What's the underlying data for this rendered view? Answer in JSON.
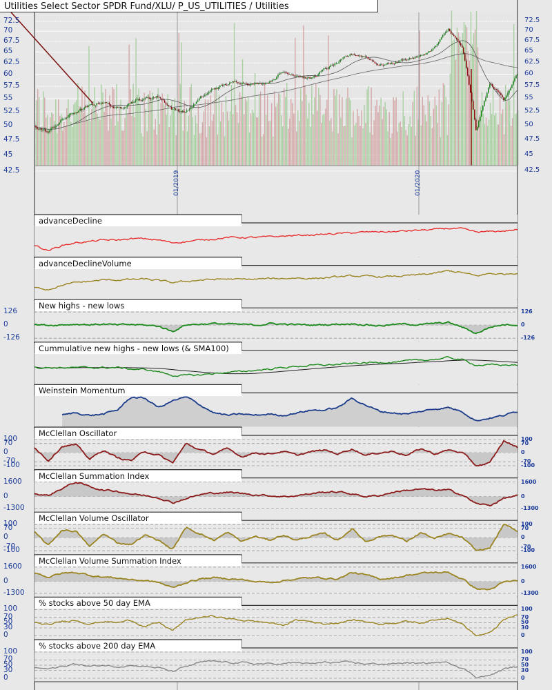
{
  "title": "Utilities Select Sector SPDR Fund/XLU/ P_US_UTILITIES / Utilities",
  "colors": {
    "up": "#1a8a1a",
    "down": "#8b1010",
    "vol_up": "#a8d0a0",
    "vol_down": "#d4a8a8",
    "axis_text": "#1a3a9a"
  },
  "chart_data": [
    {
      "type": "line",
      "name": "price",
      "title": "Utilities Select Sector SPDR Fund/XLU/ P_US_UTILITIES / Utilities",
      "y_ticks": [
        "72.5",
        "70",
        "67.5",
        "65",
        "62.5",
        "60",
        "57.5",
        "55",
        "52.5",
        "50",
        "47.5",
        "45",
        "42.5"
      ],
      "y_tick_values": [
        72.5,
        70,
        67.5,
        65,
        62.5,
        60,
        57.5,
        55,
        52.5,
        50,
        47.5,
        45,
        42.5
      ],
      "ylim": [
        42.5,
        72.5
      ],
      "x_labels": [
        "01/2019",
        "01/2020"
      ],
      "close": [
        50,
        48.8,
        51,
        52.5,
        53.5,
        54.5,
        53,
        54.5,
        55,
        55.5,
        53,
        52.5,
        55,
        57,
        58,
        58.5,
        58,
        58.5,
        60.5,
        60,
        59,
        61,
        62.5,
        64.5,
        64,
        62,
        62.5,
        63.5,
        64,
        66,
        70.5,
        66,
        49,
        58,
        55,
        60
      ],
      "overlays": [
        "SMA50",
        "SMA200"
      ]
    },
    {
      "type": "line",
      "name": "advanceDecline",
      "label": "advanceDecline",
      "color": "#e83030",
      "values": [
        0.3,
        0.1,
        0.3,
        0.4,
        0.45,
        0.5,
        0.5,
        0.55,
        0.55,
        0.5,
        0.4,
        0.45,
        0.5,
        0.55,
        0.6,
        0.6,
        0.6,
        0.62,
        0.65,
        0.68,
        0.7,
        0.72,
        0.75,
        0.78,
        0.8,
        0.82,
        0.82,
        0.85,
        0.88,
        0.9,
        0.95,
        0.92,
        0.8,
        0.82,
        0.85,
        0.9
      ]
    },
    {
      "type": "line",
      "name": "advanceDeclineVolume",
      "label": "advanceDeclineVolume",
      "color": "#9a8420",
      "values": [
        0.3,
        0.25,
        0.4,
        0.5,
        0.55,
        0.6,
        0.6,
        0.62,
        0.63,
        0.58,
        0.5,
        0.55,
        0.6,
        0.62,
        0.64,
        0.62,
        0.63,
        0.65,
        0.66,
        0.68,
        0.66,
        0.68,
        0.72,
        0.75,
        0.74,
        0.72,
        0.74,
        0.76,
        0.8,
        0.85,
        0.95,
        0.88,
        0.75,
        0.85,
        0.82,
        0.88
      ]
    },
    {
      "type": "line",
      "name": "newHighsNewLows",
      "label": "New highs - new lows",
      "color": "#1a8a1a",
      "ylim": [
        -126,
        126
      ],
      "left_ticks": [
        "126",
        "0",
        "-126"
      ],
      "right_ticks": [
        "126",
        "0",
        "-126"
      ],
      "tick_values": [
        126,
        0,
        -126
      ],
      "fill_zero": true,
      "values": [
        5,
        0,
        5,
        10,
        5,
        10,
        0,
        5,
        0,
        -10,
        -60,
        5,
        10,
        15,
        10,
        5,
        0,
        15,
        10,
        5,
        0,
        5,
        10,
        15,
        5,
        -5,
        5,
        10,
        5,
        15,
        25,
        -20,
        -80,
        -20,
        5,
        5
      ]
    },
    {
      "type": "line",
      "name": "cumulativeNewHighsNewLows",
      "label": "Cummulative new highs - new lows (& SMA100)",
      "color": "#1a8a1a",
      "overlay": "SMA100",
      "values": [
        0.5,
        0.5,
        0.5,
        0.5,
        0.5,
        0.5,
        0.5,
        0.45,
        0.42,
        0.35,
        0.2,
        0.2,
        0.22,
        0.28,
        0.32,
        0.35,
        0.4,
        0.45,
        0.5,
        0.55,
        0.58,
        0.6,
        0.62,
        0.65,
        0.68,
        0.7,
        0.72,
        0.75,
        0.78,
        0.82,
        0.88,
        0.8,
        0.6,
        0.6,
        0.6,
        0.6
      ]
    },
    {
      "type": "area",
      "name": "weinsteinMomentum",
      "label": "Weinstein Momentum",
      "color": "#1a3a8a",
      "start_index": 2,
      "values": [
        null,
        null,
        0.3,
        0.4,
        0.3,
        0.35,
        0.5,
        1.0,
        0.95,
        0.6,
        0.85,
        1.0,
        0.7,
        0.4,
        0.3,
        0.35,
        0.3,
        0.35,
        0.3,
        0.4,
        0.5,
        0.5,
        0.6,
        0.95,
        0.7,
        0.45,
        0.4,
        0.35,
        0.45,
        0.55,
        0.6,
        0.45,
        0.1,
        0.2,
        0.3,
        0.45
      ]
    },
    {
      "type": "line",
      "name": "mcclellanOscillator",
      "label": "McClellan Oscillator",
      "color": "#8b1a1a",
      "ylim": [
        -100,
        100
      ],
      "left_ticks": [
        "100",
        "70",
        "0",
        "-70",
        "-100"
      ],
      "right_ticks": [
        "100",
        "70",
        "0",
        "-70",
        "-100"
      ],
      "tick_values": [
        100,
        70,
        0,
        -70,
        -100
      ],
      "fill_zero": true,
      "values": [
        40,
        -60,
        50,
        60,
        -50,
        20,
        -40,
        -60,
        10,
        -20,
        -80,
        70,
        20,
        -10,
        30,
        -30,
        0,
        -10,
        10,
        -20,
        5,
        20,
        -10,
        30,
        -20,
        0,
        10,
        -20,
        30,
        -10,
        20,
        0,
        -100,
        -80,
        90,
        40
      ]
    },
    {
      "type": "line",
      "name": "mcclellanSummationIndex",
      "label": "McClellan Summation Index",
      "color": "#8b1a1a",
      "ylim": [
        -1300,
        1600
      ],
      "left_ticks": [
        "1600",
        "0",
        "-1300"
      ],
      "right_ticks": [
        "1600",
        "0",
        "-1300"
      ],
      "tick_values": [
        1600,
        0,
        -1300
      ],
      "fill_zero": true,
      "values": [
        300,
        100,
        900,
        1600,
        1100,
        700,
        600,
        300,
        100,
        -100,
        -700,
        -200,
        200,
        400,
        450,
        350,
        200,
        100,
        0,
        100,
        300,
        500,
        500,
        300,
        0,
        100,
        500,
        700,
        800,
        700,
        700,
        200,
        -800,
        -1000,
        -200,
        100
      ]
    },
    {
      "type": "line",
      "name": "mcclellanVolumeOscillator",
      "label": "McClellan Volume Oscillator",
      "color": "#9a8420",
      "ylim": [
        -100,
        100
      ],
      "left_ticks": [
        "100",
        "70",
        "0",
        "-70",
        "-100"
      ],
      "right_ticks": [
        "100",
        "70",
        "0",
        "-70",
        "-100"
      ],
      "tick_values": [
        100,
        70,
        0,
        -70,
        -100
      ],
      "fill_zero": true,
      "values": [
        40,
        -60,
        60,
        50,
        -70,
        30,
        -40,
        -50,
        20,
        -20,
        -90,
        80,
        30,
        -20,
        40,
        -30,
        10,
        -20,
        20,
        -20,
        10,
        30,
        -20,
        70,
        -30,
        10,
        20,
        -30,
        40,
        -10,
        30,
        0,
        -100,
        -80,
        100,
        50
      ]
    },
    {
      "type": "line",
      "name": "mcclellanVolumeSummationIndex",
      "label": "McClellan Volume Summation Index",
      "color": "#9a8420",
      "ylim": [
        -1300,
        1600
      ],
      "left_ticks": [
        "1600",
        "0",
        "-1300"
      ],
      "right_ticks": [
        "1600",
        "0",
        "-1300"
      ],
      "tick_values": [
        1600,
        0,
        -1300
      ],
      "fill_zero": true,
      "values": [
        1000,
        500,
        900,
        1000,
        700,
        500,
        400,
        200,
        100,
        -100,
        -700,
        -100,
        300,
        400,
        350,
        200,
        0,
        -100,
        100,
        300,
        400,
        400,
        300,
        1000,
        700,
        300,
        400,
        700,
        900,
        1000,
        1000,
        300,
        -800,
        -900,
        -100,
        100
      ]
    },
    {
      "type": "line",
      "name": "pctAbove50EMA",
      "label": "% stocks above 50 day EMA",
      "color": "#9a8420",
      "ylim": [
        0,
        100
      ],
      "left_ticks": [
        "100",
        "70",
        "50",
        "30",
        "0"
      ],
      "right_ticks": [
        "100",
        "70",
        "50",
        "30",
        "0"
      ],
      "tick_values": [
        100,
        70,
        50,
        30,
        0
      ],
      "fill_zero": false,
      "values": [
        50,
        40,
        55,
        60,
        45,
        55,
        50,
        60,
        35,
        50,
        20,
        60,
        70,
        75,
        65,
        60,
        55,
        50,
        40,
        60,
        55,
        45,
        50,
        60,
        55,
        45,
        50,
        55,
        50,
        60,
        70,
        45,
        0,
        10,
        60,
        80
      ]
    },
    {
      "type": "line",
      "name": "pctAbove200EMA",
      "label": "% stocks above 200 day EMA",
      "color": "#888888",
      "ylim": [
        0,
        100
      ],
      "left_ticks": [
        "100",
        "70",
        "50",
        "30",
        "0"
      ],
      "right_ticks": [
        "100",
        "70",
        "50",
        "30",
        "0"
      ],
      "tick_values": [
        100,
        70,
        50,
        30,
        0
      ],
      "fill_zero": false,
      "values": [
        40,
        35,
        45,
        55,
        45,
        50,
        45,
        50,
        45,
        40,
        25,
        45,
        60,
        65,
        60,
        60,
        55,
        55,
        55,
        60,
        55,
        60,
        60,
        60,
        55,
        55,
        55,
        60,
        55,
        60,
        60,
        40,
        5,
        10,
        35,
        45
      ]
    }
  ]
}
